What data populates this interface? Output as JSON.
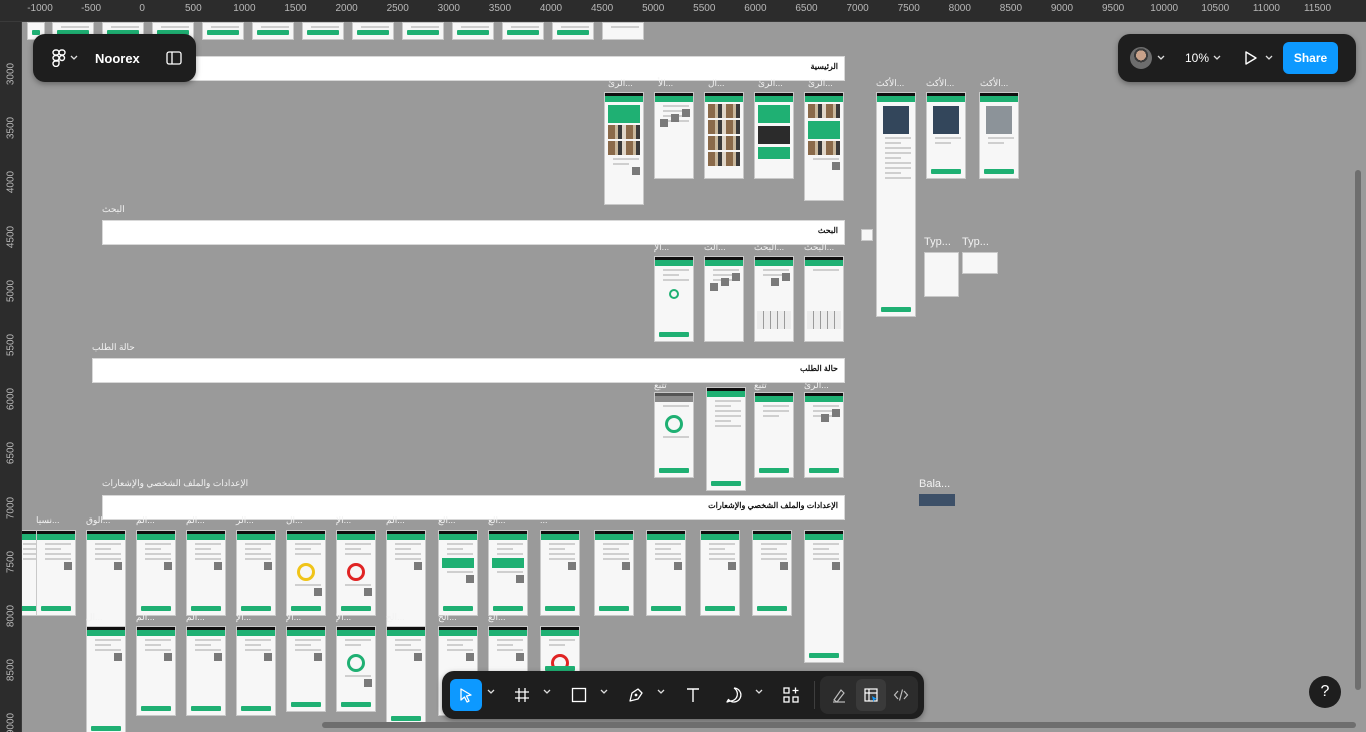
{
  "app": {
    "file_name": "Noorex",
    "zoom": "10%",
    "share_label": "Share",
    "help_label": "?"
  },
  "rulers": {
    "top": [
      "-1000",
      "-500",
      "0",
      "500",
      "1000",
      "1500",
      "2000",
      "2500",
      "3000",
      "3500",
      "4000",
      "4500",
      "5000",
      "5500",
      "6000",
      "6500",
      "7000",
      "7500",
      "8000",
      "8500",
      "9000",
      "9500",
      "10000",
      "10500",
      "11000",
      "11500"
    ],
    "left": [
      "3000",
      "3500",
      "4000",
      "4500",
      "5000",
      "5500",
      "6000",
      "6500",
      "7000",
      "7500",
      "8000",
      "8500",
      "9000"
    ]
  },
  "sections": {
    "home": {
      "banner": "الرئيسية"
    },
    "search": {
      "label": "البحث",
      "banner": "البحث"
    },
    "order_status": {
      "label": "حالة الطلب",
      "banner": "حالة الطلب"
    },
    "settings": {
      "label": "الإعدادات والملف الشخصي والإشعارات",
      "banner": "الإعدادات والملف الشخصي والإشعارات"
    }
  },
  "frame_titles": {
    "home": [
      "الرئ...",
      "الأ...",
      "ال...",
      "الرئ...",
      "الرئ..."
    ],
    "product": [
      "الأكث...",
      "الأكث...",
      "الأكث..."
    ],
    "type": [
      "Typ...",
      "Typ..."
    ],
    "search": [
      "الإ...",
      "الت...",
      "البحث...",
      "البحث..."
    ],
    "order": [
      "تتبع",
      "تتبع",
      "الرئ..."
    ],
    "balance": "Bala...",
    "settings_row": [
      "نسيا...",
      "الوق...",
      "الم...",
      "الم...",
      "الر...",
      "ال...",
      "الإ...",
      "الم...",
      "الع...",
      "الع...",
      "..."
    ],
    "settings_row2": [
      "ال...",
      "الم...",
      "الم...",
      "الإ...",
      "الإ...",
      "الإ...",
      "الح...",
      "الح...",
      "الع..."
    ]
  },
  "toolbar": {
    "tools": [
      "move-tool",
      "frame-tool",
      "shape-tool",
      "pen-tool",
      "text-tool",
      "comment-tool",
      "actions-tool"
    ],
    "modes": [
      "draw-mode",
      "design-mode",
      "dev-mode"
    ]
  },
  "colors": {
    "canvas": "#9a9a9a",
    "toolbar": "#1e1e1e",
    "accent": "#0d99ff",
    "app_green": "#1fb073"
  }
}
